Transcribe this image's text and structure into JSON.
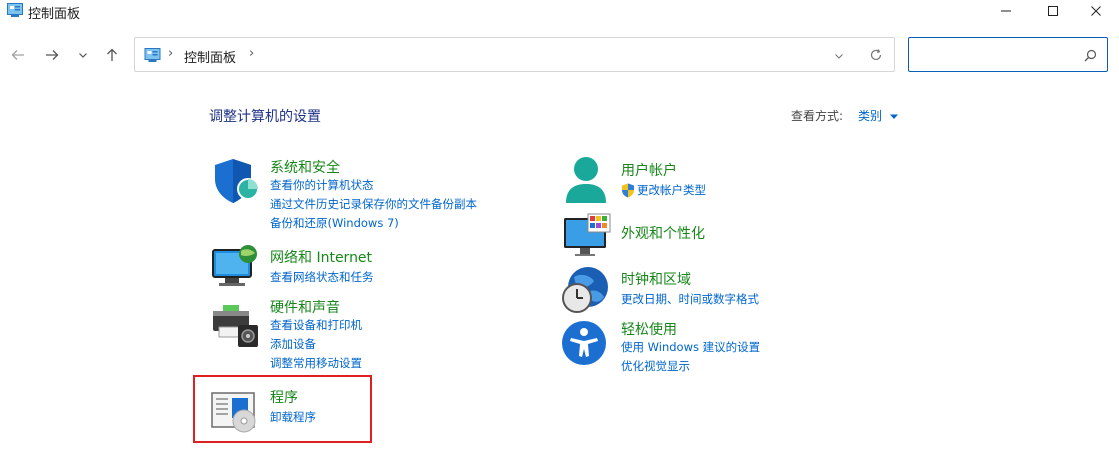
{
  "window": {
    "title": "控制面板",
    "app_icon": "control-panel-icon",
    "controls": [
      "minimize-icon",
      "maximize-icon",
      "close-icon"
    ]
  },
  "nav": {
    "back": "back-arrow-icon",
    "forward": "forward-arrow-icon",
    "recent": "chevron-down-icon",
    "up": "up-arrow-icon"
  },
  "address": {
    "path": "控制面板",
    "separator": "›"
  },
  "search": {
    "value": "",
    "placeholder": ""
  },
  "main": {
    "heading": "调整计算机的设置",
    "view_by_label": "查看方式:",
    "view_by_value": "类别"
  },
  "categories_left": [
    {
      "title": "系统和安全",
      "icon": "shield-icon",
      "links": [
        "查看你的计算机状态",
        "通过文件历史记录保存你的文件备份副本",
        "备份和还原(Windows 7)"
      ]
    },
    {
      "title": "网络和 Internet",
      "icon": "network-globe-icon",
      "links": [
        "查看网络状态和任务"
      ]
    },
    {
      "title": "硬件和声音",
      "icon": "printer-speaker-icon",
      "links": [
        "查看设备和打印机",
        "添加设备",
        "调整常用移动设置"
      ]
    },
    {
      "title": "程序",
      "icon": "programs-disc-icon",
      "links": [
        "卸载程序"
      ]
    }
  ],
  "categories_right": [
    {
      "title": "用户帐户",
      "icon": "user-icon",
      "links": [
        "更改帐户类型"
      ]
    },
    {
      "title": "外观和个性化",
      "icon": "monitor-palette-icon",
      "links": []
    },
    {
      "title": "时钟和区域",
      "icon": "clock-globe-icon",
      "links": [
        "更改日期、时间或数字格式"
      ]
    },
    {
      "title": "轻松使用",
      "icon": "accessibility-icon",
      "links": [
        "使用 Windows 建议的设置",
        "优化视觉显示"
      ]
    }
  ],
  "colors": {
    "heading": "#1e3287",
    "category_title": "#168718",
    "link": "#0066cc",
    "highlight": "#e02020"
  }
}
